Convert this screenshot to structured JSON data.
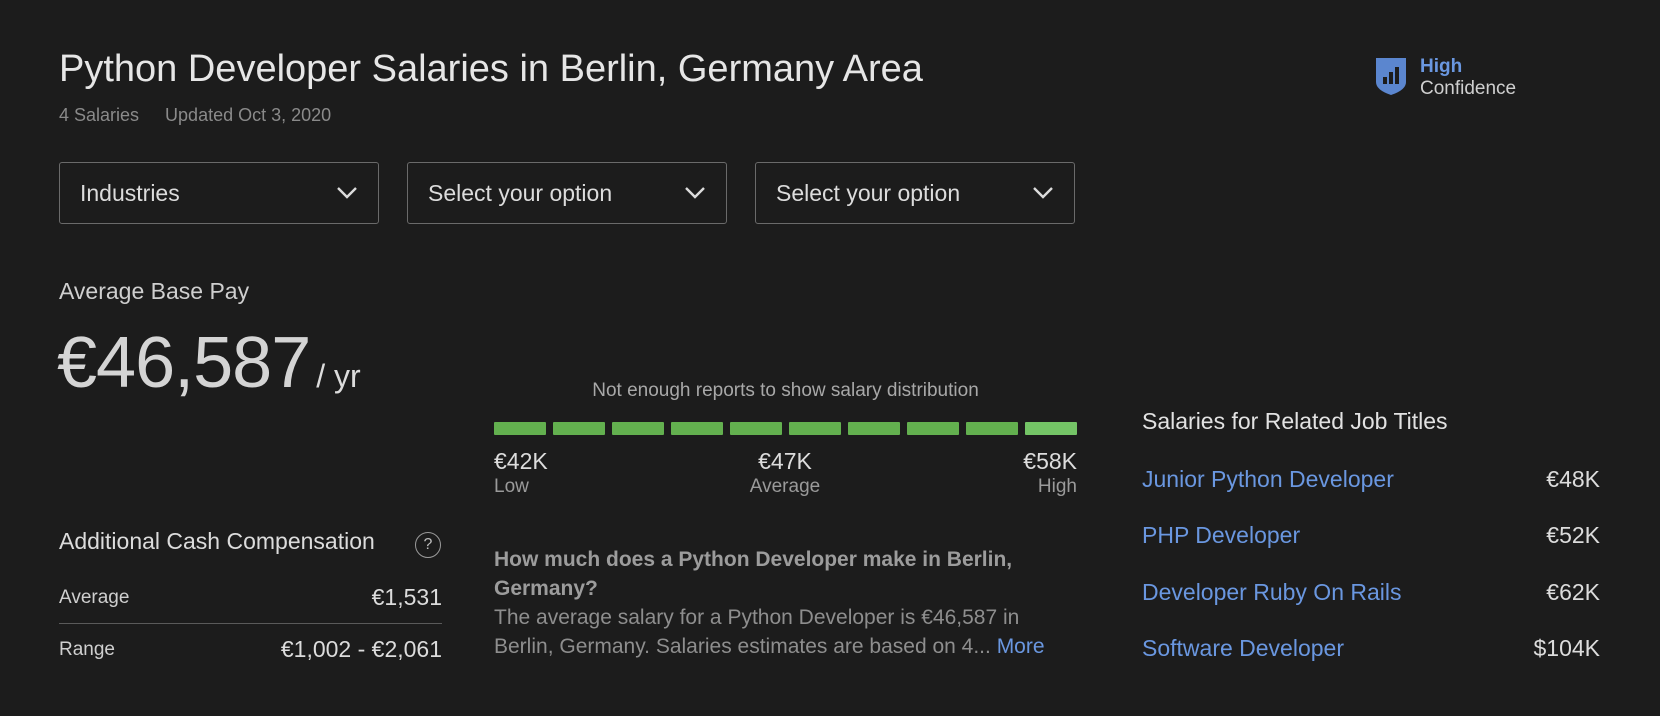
{
  "header": {
    "title": "Python Developer Salaries in Berlin, Germany Area",
    "salary_count": "4 Salaries",
    "updated": "Updated Oct 3, 2020",
    "confidence_level": "High",
    "confidence_label": "Confidence",
    "confidence_icon": "shield-bar-chart-icon"
  },
  "filters": [
    {
      "label": "Industries"
    },
    {
      "label": "Select your option"
    },
    {
      "label": "Select your option"
    }
  ],
  "base_pay": {
    "label": "Average Base Pay",
    "amount": "€46,587",
    "unit": "/ yr"
  },
  "distribution": {
    "note": "Not enough reports to show salary distribution",
    "segment_count": 10,
    "highlighted_segment": 9,
    "bar_color": "#63b04f",
    "low_value": "€42K",
    "low_label": "Low",
    "avg_value": "€47K",
    "avg_label": "Average",
    "high_value": "€58K",
    "high_label": "High"
  },
  "additional": {
    "title": "Additional Cash Compensation",
    "help": "?",
    "average_label": "Average",
    "average_value": "€1,531",
    "range_label": "Range",
    "range_value": "€1,002 - €2,061"
  },
  "faq": {
    "question": "How much does a Python Developer make in Berlin, Germany?",
    "answer": "The average salary for a Python Developer is €46,587 in Berlin, Germany. Salaries estimates are based on 4...",
    "more": "More"
  },
  "related": {
    "title": "Salaries for Related Job Titles",
    "items": [
      {
        "name": "Junior Python Developer",
        "value": "€48K"
      },
      {
        "name": "PHP Developer",
        "value": "€52K"
      },
      {
        "name": "Developer Ruby On Rails",
        "value": "€62K"
      },
      {
        "name": "Software Developer",
        "value": "$104K"
      }
    ]
  },
  "colors": {
    "background": "#1c1c1c",
    "accent": "#6a97e0",
    "bar": "#63b04f"
  }
}
